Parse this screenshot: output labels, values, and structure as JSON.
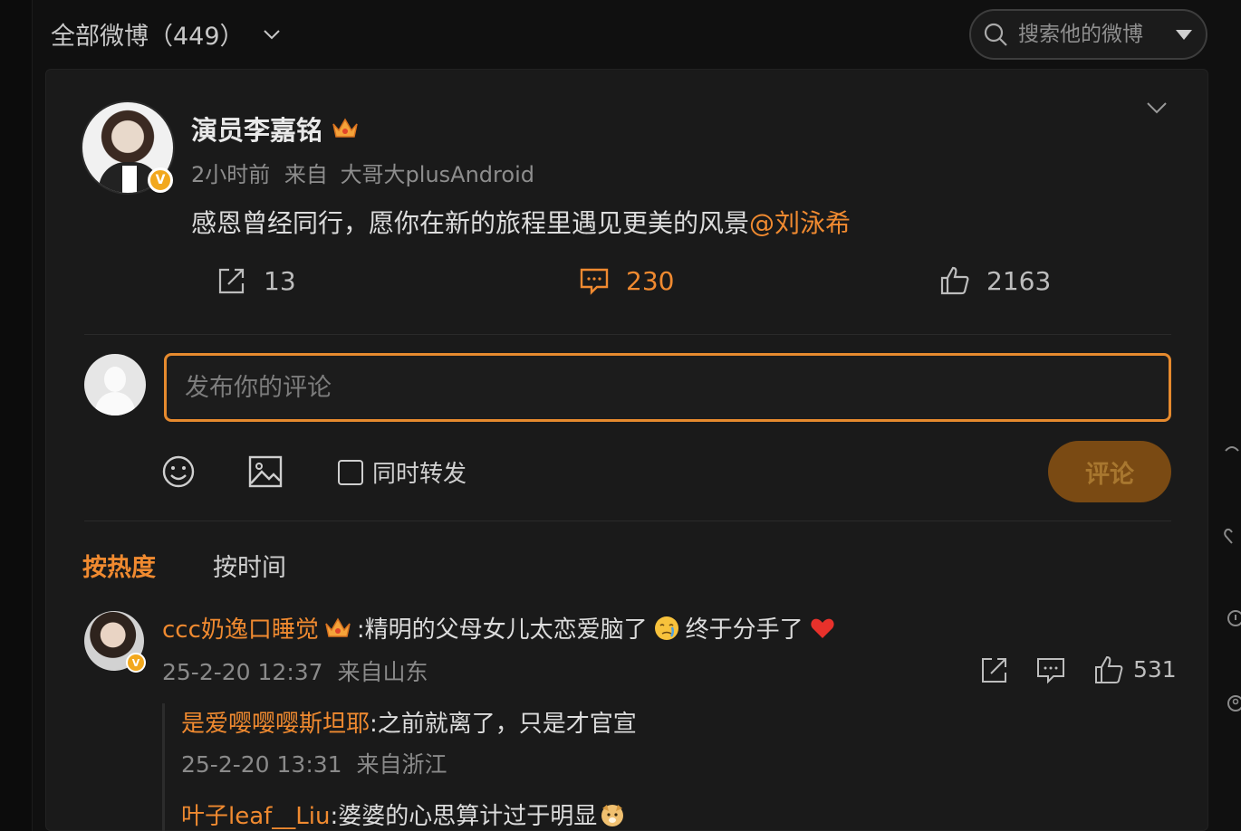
{
  "topbar": {
    "filter_label": "全部微博（449）",
    "search_placeholder": "搜索他的微博"
  },
  "post": {
    "author": "演员李嘉铭",
    "time": "2小时前",
    "source_prefix": "来自",
    "source": "大哥大plusAndroid",
    "text": "感恩曾经同行，愿你在新的旅程里遇见更美的风景",
    "mention": "@刘泳希",
    "repost_count": "13",
    "comment_count": "230",
    "like_count": "2163"
  },
  "composer": {
    "placeholder": "发布你的评论",
    "repost_label": "同时转发",
    "submit_label": "评论"
  },
  "sort": {
    "hot": "按热度",
    "time": "按时间"
  },
  "comments": [
    {
      "name": "ccc奶逸口睡觉",
      "text_a": ":精明的父母女儿太恋爱脑了",
      "text_b": "终于分手了",
      "time": "25-2-20 12:37",
      "location": "来自山东",
      "like_count": "531",
      "replies": [
        {
          "name": "是爱嘤嘤嘤斯坦耶",
          "text": ":之前就离了，只是才官宣",
          "time": "25-2-20 13:31",
          "location": "来自浙江"
        },
        {
          "name": "叶子leaf__Liu",
          "text": ":婆婆的心思算计过于明显"
        }
      ]
    }
  ],
  "colors": {
    "accent": "#f08a30",
    "verified": "#f2a81d",
    "background": "#101010",
    "card": "#1a1a1a"
  },
  "icons": [
    "chevron-down-icon",
    "search-icon",
    "dropdown-triangle-icon",
    "crown-icon",
    "verified-icon",
    "repost-icon",
    "comment-icon",
    "like-icon",
    "emoji-icon",
    "image-icon",
    "heart-icon"
  ]
}
